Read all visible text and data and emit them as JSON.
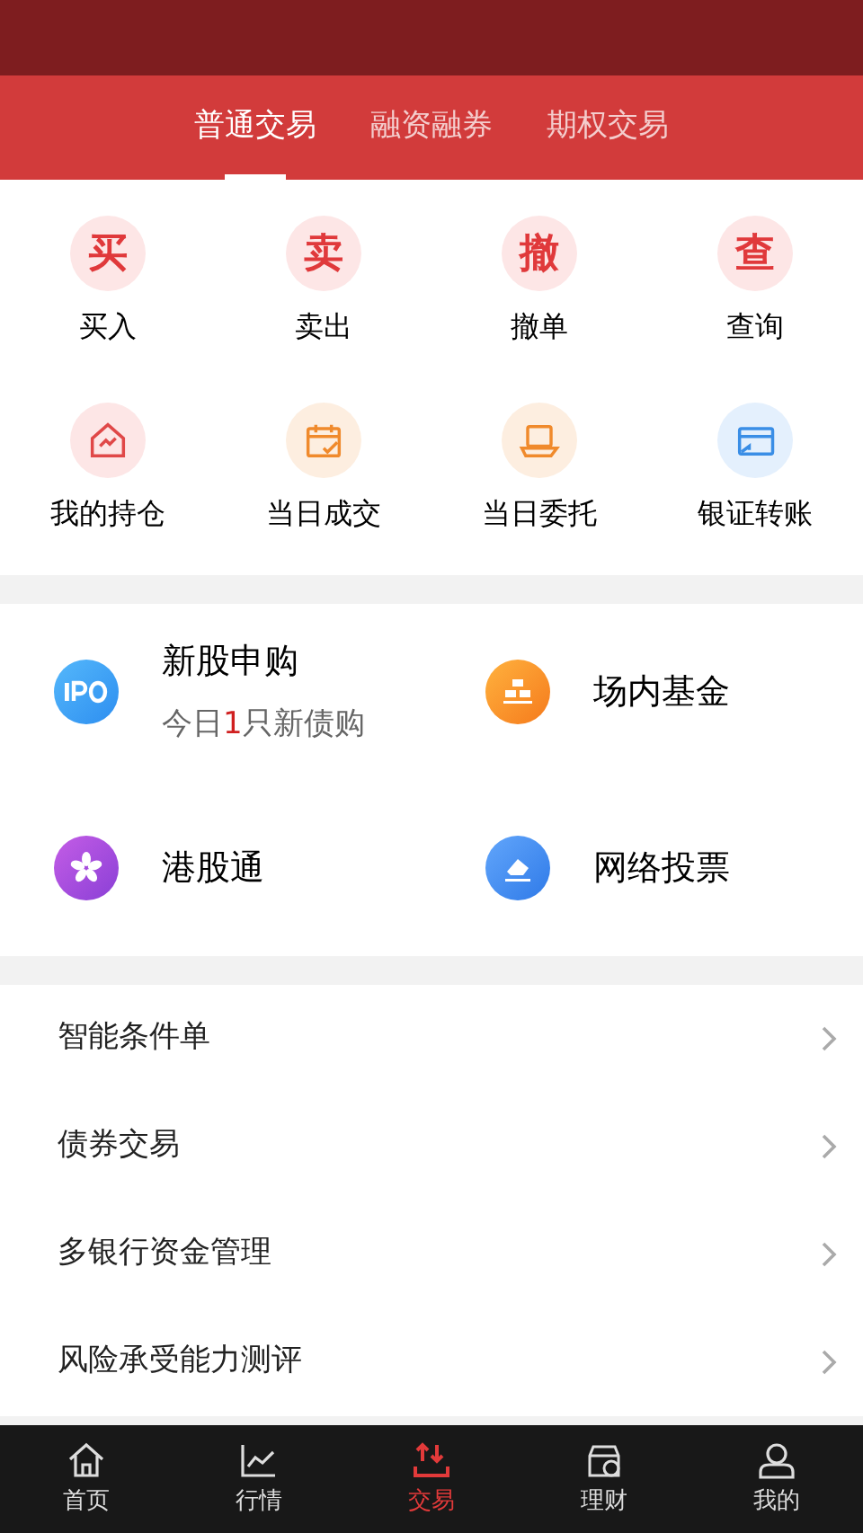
{
  "tabs": [
    {
      "label": "普通交易",
      "selected": true
    },
    {
      "label": "融资融券",
      "selected": false
    },
    {
      "label": "期权交易",
      "selected": false
    }
  ],
  "quick_actions": [
    {
      "glyph": "买",
      "label": "买入"
    },
    {
      "glyph": "卖",
      "label": "卖出"
    },
    {
      "glyph": "撤",
      "label": "撤单"
    },
    {
      "glyph": "查",
      "label": "查询"
    }
  ],
  "shortcuts": [
    {
      "label": "我的持仓"
    },
    {
      "label": "当日成交"
    },
    {
      "label": "当日委托"
    },
    {
      "label": "银证转账"
    }
  ],
  "services": [
    {
      "title": "新股申购",
      "note": {
        "before": "今日",
        "count": "1",
        "after": "只新债购"
      }
    },
    {
      "title": "场内基金"
    },
    {
      "title": "港股通"
    },
    {
      "title": "网络投票"
    }
  ],
  "menu": [
    {
      "label": "智能条件单"
    },
    {
      "label": "债券交易"
    },
    {
      "label": "多银行资金管理"
    },
    {
      "label": "风险承受能力测评"
    }
  ],
  "bottom_nav": [
    {
      "label": "首页",
      "selected": false
    },
    {
      "label": "行情",
      "selected": false
    },
    {
      "label": "交易",
      "selected": true
    },
    {
      "label": "理财",
      "selected": false
    },
    {
      "label": "我的",
      "selected": false
    }
  ]
}
